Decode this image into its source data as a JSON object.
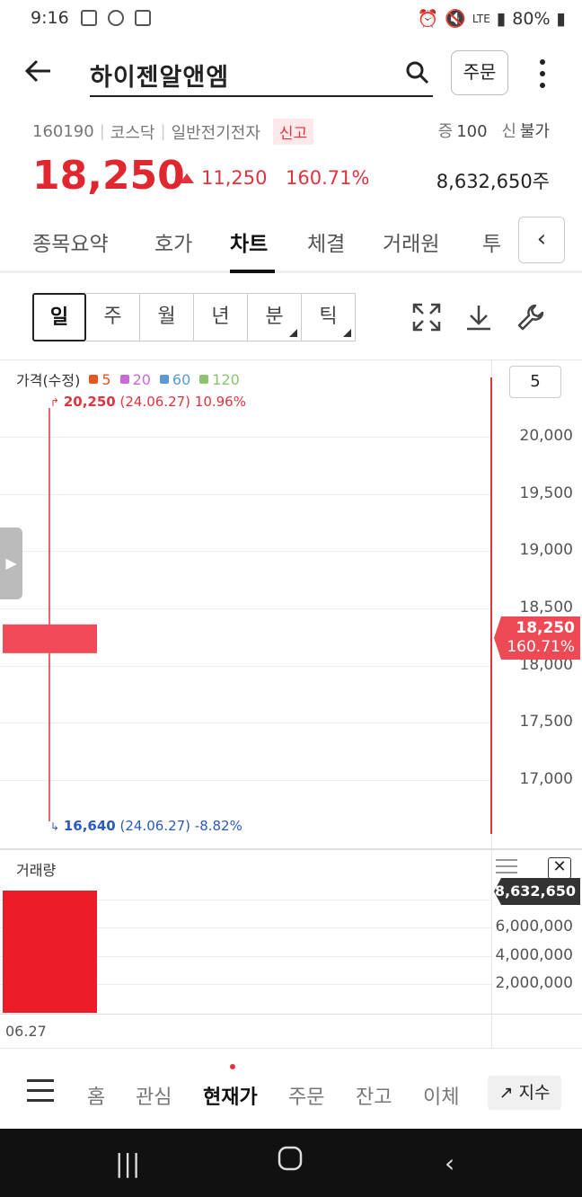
{
  "status_bar": {
    "time": "9:16",
    "battery": "80%",
    "network": "LTE"
  },
  "header": {
    "stock_name": "하이젠알앤엠",
    "order_button": "주문"
  },
  "stock": {
    "code": "160190",
    "market": "코스닥",
    "sector": "일반전기전자",
    "badge": "신고",
    "margin_label": "증",
    "margin_value": "100",
    "credit_label": "신",
    "credit_value": "불가",
    "price": "18,250",
    "change": "11,250",
    "change_pct": "160.71%",
    "volume": "8,632,650주"
  },
  "tabs": [
    "종목요약",
    "호가",
    "차트",
    "체결",
    "거래원",
    "투"
  ],
  "active_tab": "차트",
  "periods": [
    "일",
    "주",
    "월",
    "년",
    "분",
    "틱"
  ],
  "chart_data": {
    "type": "candlestick",
    "panel_title": "가격(수정)",
    "ma_legend": [
      {
        "label": "5",
        "color": "#e8541e"
      },
      {
        "label": "20",
        "color": "#c86ad6"
      },
      {
        "label": "60",
        "color": "#5b9bd5"
      },
      {
        "label": "120",
        "color": "#8dc26f"
      }
    ],
    "period_setting": "5",
    "y_ticks": [
      "20,000",
      "19,500",
      "19,000",
      "18,500",
      "18,000",
      "17,500",
      "17,000"
    ],
    "ylim": [
      16640,
      20250
    ],
    "candles": [
      {
        "date": "06.27",
        "open": 18240,
        "high": 20250,
        "low": 16640,
        "close": 18250,
        "volume": 8632650
      }
    ],
    "high_label": {
      "price": "20,250",
      "detail": "(24.06.27) 10.96%"
    },
    "low_label": {
      "price": "16,640",
      "detail": "(24.06.27) -8.82%"
    },
    "current_tag": {
      "price": "18,250",
      "pct": "160.71%"
    },
    "volume_panel": {
      "title": "거래량",
      "y_ticks": [
        "6,000,000",
        "4,000,000",
        "2,000,000"
      ],
      "current_tag": "8,632,650"
    },
    "x_labels": [
      "06.27"
    ]
  },
  "bottom_nav": {
    "items": [
      "홈",
      "관심",
      "현재가",
      "주문",
      "잔고",
      "이체"
    ],
    "active": "현재가",
    "index_button": "지수"
  },
  "colors": {
    "up": "#e0343e",
    "down": "#2a5bbf",
    "candle": "#f04a58",
    "volume_bar": "#ec1c29"
  }
}
